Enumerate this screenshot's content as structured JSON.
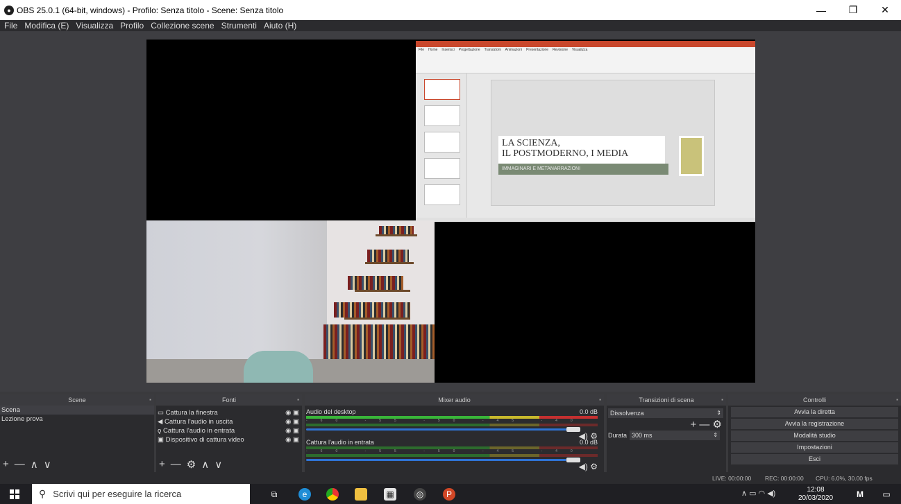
{
  "window": {
    "title": "OBS 25.0.1 (64-bit, windows) - Profilo: Senza titolo - Scene: Senza titolo",
    "minimize": "—",
    "maximize": "❐",
    "close": "✕"
  },
  "menu": [
    "File",
    "Modifica (E)",
    "Visualizza",
    "Profilo",
    "Collezione scene",
    "Strumenti",
    "Aiuto (H)"
  ],
  "preview": {
    "slide_title_1": "LA SCIENZA,",
    "slide_title_2": "IL POSTMODERNO, I MEDIA",
    "slide_subtitle": "IMMAGINARI E METANARRAZIONI"
  },
  "scenes": {
    "title": "Scene",
    "items": [
      "Scena",
      "Lezione prova"
    ],
    "tools": [
      "+",
      "—",
      "∧",
      "∨"
    ]
  },
  "sources": {
    "title": "Fonti",
    "items": [
      {
        "icon": "window-icon",
        "label": "Cattura la finestra"
      },
      {
        "icon": "speaker-icon",
        "label": "Cattura l'audio in uscita"
      },
      {
        "icon": "microphone-icon",
        "label": "Cattura l'audio in entrata"
      },
      {
        "icon": "camera-icon",
        "label": "Dispositivo di cattura video"
      }
    ],
    "tools": [
      "+",
      "—",
      "⚙",
      "∧",
      "∨"
    ]
  },
  "mixer": {
    "title": "Mixer audio",
    "tracks": [
      {
        "name": "Audio del desktop",
        "level": "0.0 dB",
        "volume": 1.0
      },
      {
        "name": "Cattura l'audio in entrata",
        "level": "0.0 dB",
        "volume": 1.0
      }
    ],
    "ticks": "-60 -55 -50 -45 -40 -35 -30 -25 -20 -15 -10 -5 0"
  },
  "transitions": {
    "title": "Transizioni di scena",
    "selected": "Dissolvenza",
    "duration_label": "Durata",
    "duration_value": "300 ms"
  },
  "controls": {
    "title": "Controlli",
    "buttons": [
      "Avvia la diretta",
      "Avvia la registrazione",
      "Modalità studio",
      "Impostazioni",
      "Esci"
    ]
  },
  "status": {
    "live": "LIVE: 00:00:00",
    "rec": "REC: 00:00:00",
    "cpu": "CPU: 6.0%, 30.00 fps"
  },
  "taskbar": {
    "search_placeholder": "Scrivi qui per eseguire la ricerca",
    "time": "12:08",
    "date": "20/03/2020"
  }
}
